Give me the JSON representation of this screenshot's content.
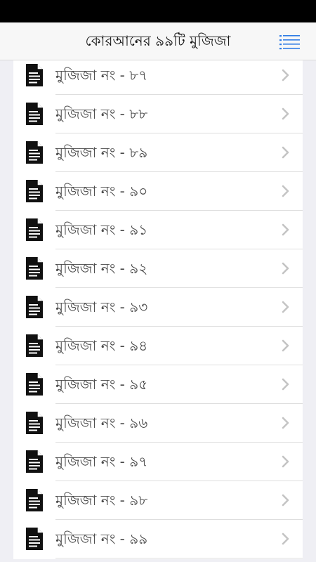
{
  "header": {
    "title": "কোরআনের ৯৯টি মুজিজা",
    "menu_icon": "list-menu-icon"
  },
  "colors": {
    "accent": "#2f7be5",
    "chevron": "#c4c4c4",
    "text": "#4a4a4a"
  },
  "list": {
    "items": [
      {
        "label": "মুজিজা নং - ৮৭",
        "icon": "document-icon"
      },
      {
        "label": "মুজিজা নং - ৮৮",
        "icon": "document-icon"
      },
      {
        "label": "মুজিজা নং - ৮৯",
        "icon": "document-icon"
      },
      {
        "label": "মুজিজা নং - ৯০",
        "icon": "document-icon"
      },
      {
        "label": "মুজিজা নং - ৯১",
        "icon": "document-icon"
      },
      {
        "label": "মুজিজা নং - ৯২",
        "icon": "document-icon"
      },
      {
        "label": "মুজিজা নং - ৯৩",
        "icon": "document-icon"
      },
      {
        "label": "মুজিজা নং - ৯৪",
        "icon": "document-icon"
      },
      {
        "label": "মুজিজা নং - ৯৫",
        "icon": "document-icon"
      },
      {
        "label": "মুজিজা নং - ৯৬",
        "icon": "document-icon"
      },
      {
        "label": "মুজিজা নং - ৯৭",
        "icon": "document-icon"
      },
      {
        "label": "মুজিজা নং - ৯৮",
        "icon": "document-icon"
      },
      {
        "label": "মুজিজা নং - ৯৯",
        "icon": "document-icon"
      }
    ]
  }
}
